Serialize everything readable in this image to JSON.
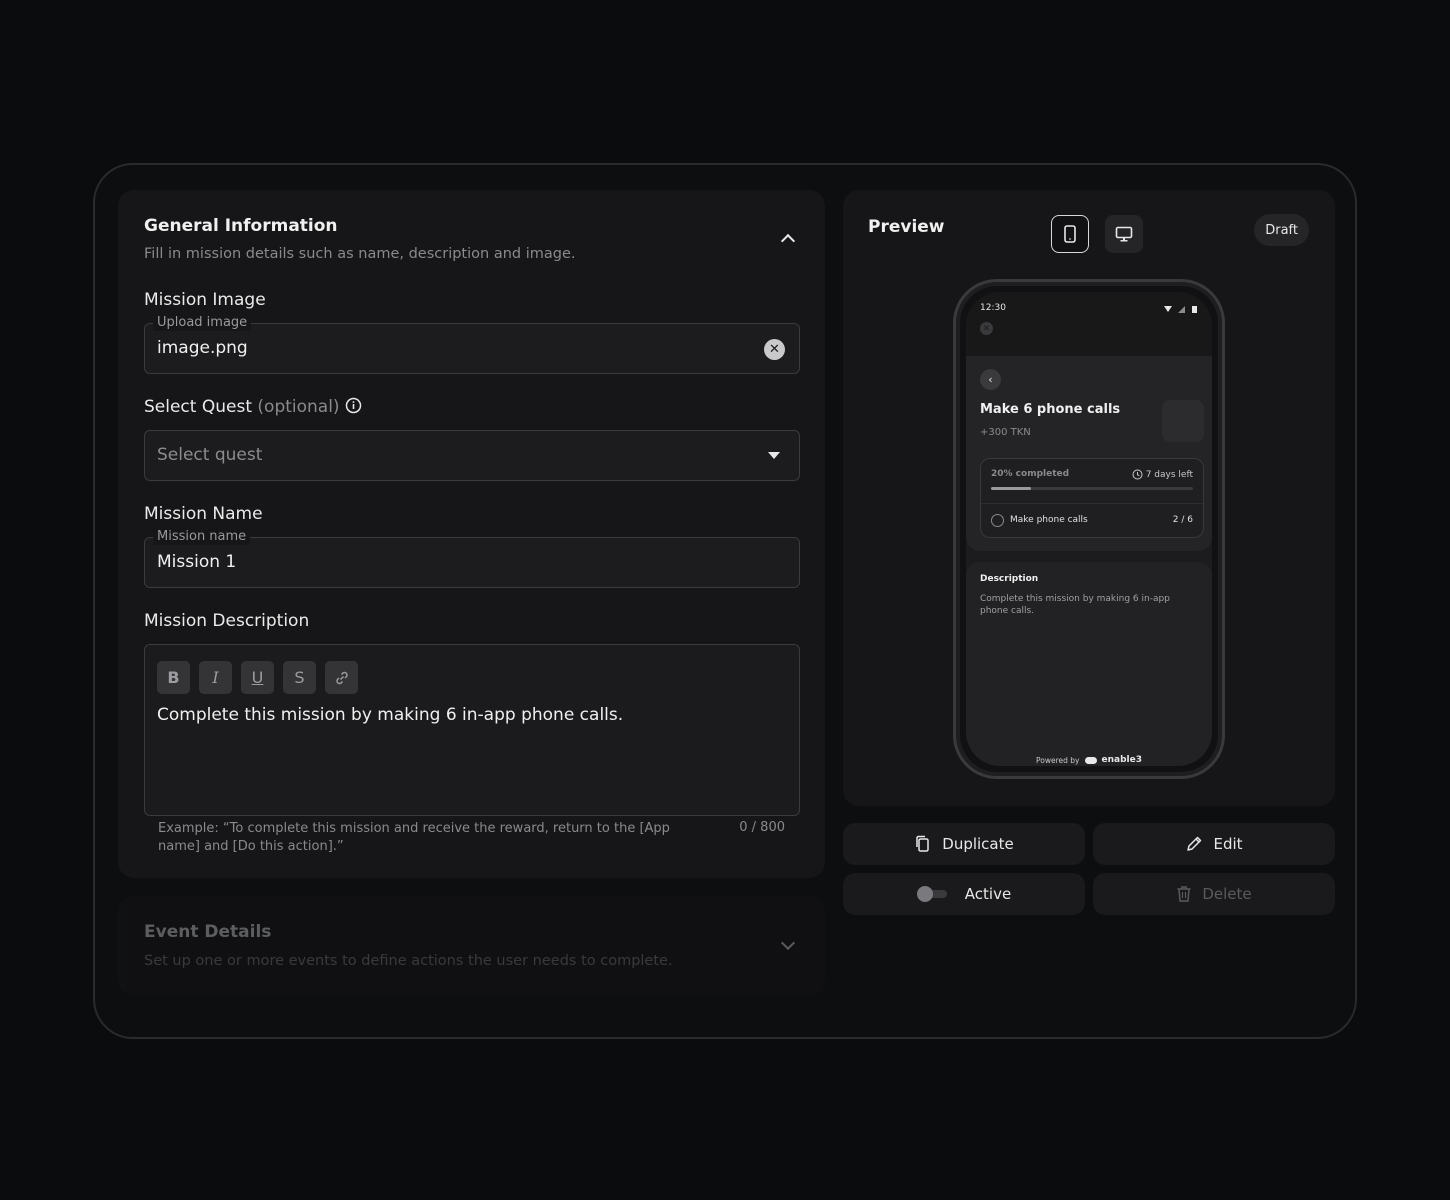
{
  "general": {
    "title": "General Information",
    "subtitle": "Fill in mission details such as name, description and image."
  },
  "image": {
    "label": "Mission Image",
    "legend": "Upload image",
    "value": "image.png"
  },
  "quest": {
    "label": "Select Quest",
    "optional": "(optional)",
    "placeholder": "Select quest"
  },
  "name": {
    "label": "Mission Name",
    "legend": "Mission name",
    "value": "Mission 1"
  },
  "description": {
    "label": "Mission Description",
    "text": "Complete this mission by making 6 in-app phone calls.",
    "hint": "Example: “To complete this mission and receive the reward, return to the [App name] and [Do this action].”",
    "count": "0 / 800",
    "toolbar": {
      "bold": "B",
      "italic": "I",
      "underline": "U",
      "strike": "S"
    }
  },
  "events": {
    "title": "Event Details",
    "subtitle": "Set up one or more events to define actions the user needs to complete."
  },
  "preview": {
    "title": "Preview",
    "status": "Draft",
    "phone": {
      "time": "12:30",
      "mission_title": "Make 6 phone calls",
      "reward": "+300 TKN",
      "progress_label": "20% completed",
      "progress": 0.2,
      "days_left": "7 days left",
      "task": "Make phone calls",
      "task_count": "2 / 6",
      "desc_title": "Description",
      "desc_text": "Complete this mission by making 6 in-app phone calls.",
      "powered": "Powered by",
      "brand": "enable3"
    }
  },
  "actions": {
    "duplicate": "Duplicate",
    "edit": "Edit",
    "active": "Active",
    "delete": "Delete"
  }
}
